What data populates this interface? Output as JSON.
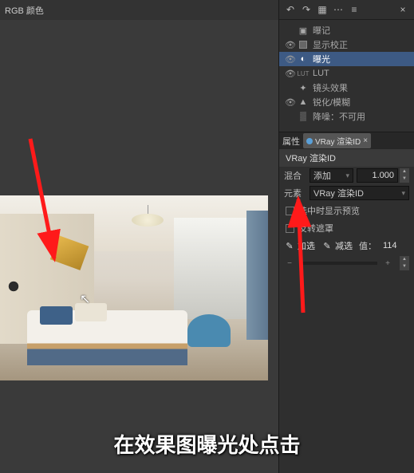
{
  "toolbar": {
    "mode_label": "RGB 颜色"
  },
  "layers": {
    "items": [
      {
        "label": "曝记",
        "eye": false
      },
      {
        "label": "显示校正",
        "eye": true
      },
      {
        "label": "曝光",
        "eye": true,
        "highlight": true
      },
      {
        "label": "LUT",
        "eye": true
      },
      {
        "label": "镜头效果",
        "eye": false
      },
      {
        "label": "锐化/模糊",
        "eye": true
      },
      {
        "label": "降噪：不可用",
        "eye": false
      }
    ]
  },
  "properties": {
    "panel_label": "属性",
    "tab_label": "VRay 渲染ID",
    "section_title": "VRay 渲染ID",
    "mix_label": "混合",
    "mix_value": "添加",
    "mix_num": "1.000",
    "yuansu_label": "元素",
    "yuansu_value": "VRay 渲染ID",
    "chk_preview": "选中时显示预览",
    "chk_invert": "反转遮罩",
    "add_label": "加选",
    "sub_label": "减选",
    "value_label": "值：",
    "value_num": "114"
  },
  "caption": "在效果图曝光处点击"
}
